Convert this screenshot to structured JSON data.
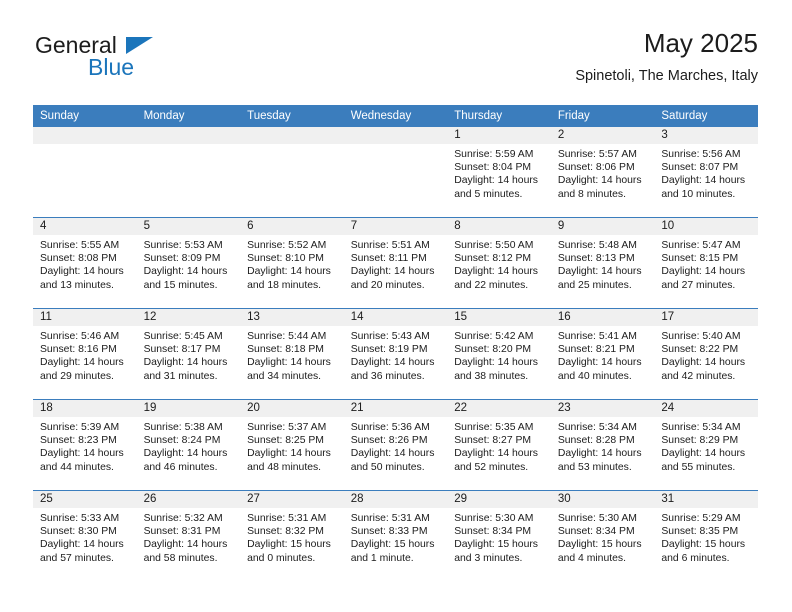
{
  "brand": {
    "name_part1": "General",
    "name_part2": "Blue",
    "logo_icon": "triangle-logo-icon",
    "accent_color": "#1b75bb"
  },
  "header": {
    "title": "May 2025",
    "subtitle": "Spinetoli, The Marches, Italy"
  },
  "calendar": {
    "header_color": "#3b7dbd",
    "weekday_headers": [
      "Sunday",
      "Monday",
      "Tuesday",
      "Wednesday",
      "Thursday",
      "Friday",
      "Saturday"
    ],
    "weeks": [
      [
        {
          "day": "",
          "empty": true
        },
        {
          "day": "",
          "empty": true
        },
        {
          "day": "",
          "empty": true
        },
        {
          "day": "",
          "empty": true
        },
        {
          "day": "1",
          "sunrise": "Sunrise: 5:59 AM",
          "sunset": "Sunset: 8:04 PM",
          "daylight_line1": "Daylight: 14 hours",
          "daylight_line2": "and 5 minutes."
        },
        {
          "day": "2",
          "sunrise": "Sunrise: 5:57 AM",
          "sunset": "Sunset: 8:06 PM",
          "daylight_line1": "Daylight: 14 hours",
          "daylight_line2": "and 8 minutes."
        },
        {
          "day": "3",
          "sunrise": "Sunrise: 5:56 AM",
          "sunset": "Sunset: 8:07 PM",
          "daylight_line1": "Daylight: 14 hours",
          "daylight_line2": "and 10 minutes."
        }
      ],
      [
        {
          "day": "4",
          "sunrise": "Sunrise: 5:55 AM",
          "sunset": "Sunset: 8:08 PM",
          "daylight_line1": "Daylight: 14 hours",
          "daylight_line2": "and 13 minutes."
        },
        {
          "day": "5",
          "sunrise": "Sunrise: 5:53 AM",
          "sunset": "Sunset: 8:09 PM",
          "daylight_line1": "Daylight: 14 hours",
          "daylight_line2": "and 15 minutes."
        },
        {
          "day": "6",
          "sunrise": "Sunrise: 5:52 AM",
          "sunset": "Sunset: 8:10 PM",
          "daylight_line1": "Daylight: 14 hours",
          "daylight_line2": "and 18 minutes."
        },
        {
          "day": "7",
          "sunrise": "Sunrise: 5:51 AM",
          "sunset": "Sunset: 8:11 PM",
          "daylight_line1": "Daylight: 14 hours",
          "daylight_line2": "and 20 minutes."
        },
        {
          "day": "8",
          "sunrise": "Sunrise: 5:50 AM",
          "sunset": "Sunset: 8:12 PM",
          "daylight_line1": "Daylight: 14 hours",
          "daylight_line2": "and 22 minutes."
        },
        {
          "day": "9",
          "sunrise": "Sunrise: 5:48 AM",
          "sunset": "Sunset: 8:13 PM",
          "daylight_line1": "Daylight: 14 hours",
          "daylight_line2": "and 25 minutes."
        },
        {
          "day": "10",
          "sunrise": "Sunrise: 5:47 AM",
          "sunset": "Sunset: 8:15 PM",
          "daylight_line1": "Daylight: 14 hours",
          "daylight_line2": "and 27 minutes."
        }
      ],
      [
        {
          "day": "11",
          "sunrise": "Sunrise: 5:46 AM",
          "sunset": "Sunset: 8:16 PM",
          "daylight_line1": "Daylight: 14 hours",
          "daylight_line2": "and 29 minutes."
        },
        {
          "day": "12",
          "sunrise": "Sunrise: 5:45 AM",
          "sunset": "Sunset: 8:17 PM",
          "daylight_line1": "Daylight: 14 hours",
          "daylight_line2": "and 31 minutes."
        },
        {
          "day": "13",
          "sunrise": "Sunrise: 5:44 AM",
          "sunset": "Sunset: 8:18 PM",
          "daylight_line1": "Daylight: 14 hours",
          "daylight_line2": "and 34 minutes."
        },
        {
          "day": "14",
          "sunrise": "Sunrise: 5:43 AM",
          "sunset": "Sunset: 8:19 PM",
          "daylight_line1": "Daylight: 14 hours",
          "daylight_line2": "and 36 minutes."
        },
        {
          "day": "15",
          "sunrise": "Sunrise: 5:42 AM",
          "sunset": "Sunset: 8:20 PM",
          "daylight_line1": "Daylight: 14 hours",
          "daylight_line2": "and 38 minutes."
        },
        {
          "day": "16",
          "sunrise": "Sunrise: 5:41 AM",
          "sunset": "Sunset: 8:21 PM",
          "daylight_line1": "Daylight: 14 hours",
          "daylight_line2": "and 40 minutes."
        },
        {
          "day": "17",
          "sunrise": "Sunrise: 5:40 AM",
          "sunset": "Sunset: 8:22 PM",
          "daylight_line1": "Daylight: 14 hours",
          "daylight_line2": "and 42 minutes."
        }
      ],
      [
        {
          "day": "18",
          "sunrise": "Sunrise: 5:39 AM",
          "sunset": "Sunset: 8:23 PM",
          "daylight_line1": "Daylight: 14 hours",
          "daylight_line2": "and 44 minutes."
        },
        {
          "day": "19",
          "sunrise": "Sunrise: 5:38 AM",
          "sunset": "Sunset: 8:24 PM",
          "daylight_line1": "Daylight: 14 hours",
          "daylight_line2": "and 46 minutes."
        },
        {
          "day": "20",
          "sunrise": "Sunrise: 5:37 AM",
          "sunset": "Sunset: 8:25 PM",
          "daylight_line1": "Daylight: 14 hours",
          "daylight_line2": "and 48 minutes."
        },
        {
          "day": "21",
          "sunrise": "Sunrise: 5:36 AM",
          "sunset": "Sunset: 8:26 PM",
          "daylight_line1": "Daylight: 14 hours",
          "daylight_line2": "and 50 minutes."
        },
        {
          "day": "22",
          "sunrise": "Sunrise: 5:35 AM",
          "sunset": "Sunset: 8:27 PM",
          "daylight_line1": "Daylight: 14 hours",
          "daylight_line2": "and 52 minutes."
        },
        {
          "day": "23",
          "sunrise": "Sunrise: 5:34 AM",
          "sunset": "Sunset: 8:28 PM",
          "daylight_line1": "Daylight: 14 hours",
          "daylight_line2": "and 53 minutes."
        },
        {
          "day": "24",
          "sunrise": "Sunrise: 5:34 AM",
          "sunset": "Sunset: 8:29 PM",
          "daylight_line1": "Daylight: 14 hours",
          "daylight_line2": "and 55 minutes."
        }
      ],
      [
        {
          "day": "25",
          "sunrise": "Sunrise: 5:33 AM",
          "sunset": "Sunset: 8:30 PM",
          "daylight_line1": "Daylight: 14 hours",
          "daylight_line2": "and 57 minutes."
        },
        {
          "day": "26",
          "sunrise": "Sunrise: 5:32 AM",
          "sunset": "Sunset: 8:31 PM",
          "daylight_line1": "Daylight: 14 hours",
          "daylight_line2": "and 58 minutes."
        },
        {
          "day": "27",
          "sunrise": "Sunrise: 5:31 AM",
          "sunset": "Sunset: 8:32 PM",
          "daylight_line1": "Daylight: 15 hours",
          "daylight_line2": "and 0 minutes."
        },
        {
          "day": "28",
          "sunrise": "Sunrise: 5:31 AM",
          "sunset": "Sunset: 8:33 PM",
          "daylight_line1": "Daylight: 15 hours",
          "daylight_line2": "and 1 minute."
        },
        {
          "day": "29",
          "sunrise": "Sunrise: 5:30 AM",
          "sunset": "Sunset: 8:34 PM",
          "daylight_line1": "Daylight: 15 hours",
          "daylight_line2": "and 3 minutes."
        },
        {
          "day": "30",
          "sunrise": "Sunrise: 5:30 AM",
          "sunset": "Sunset: 8:34 PM",
          "daylight_line1": "Daylight: 15 hours",
          "daylight_line2": "and 4 minutes."
        },
        {
          "day": "31",
          "sunrise": "Sunrise: 5:29 AM",
          "sunset": "Sunset: 8:35 PM",
          "daylight_line1": "Daylight: 15 hours",
          "daylight_line2": "and 6 minutes."
        }
      ]
    ]
  }
}
